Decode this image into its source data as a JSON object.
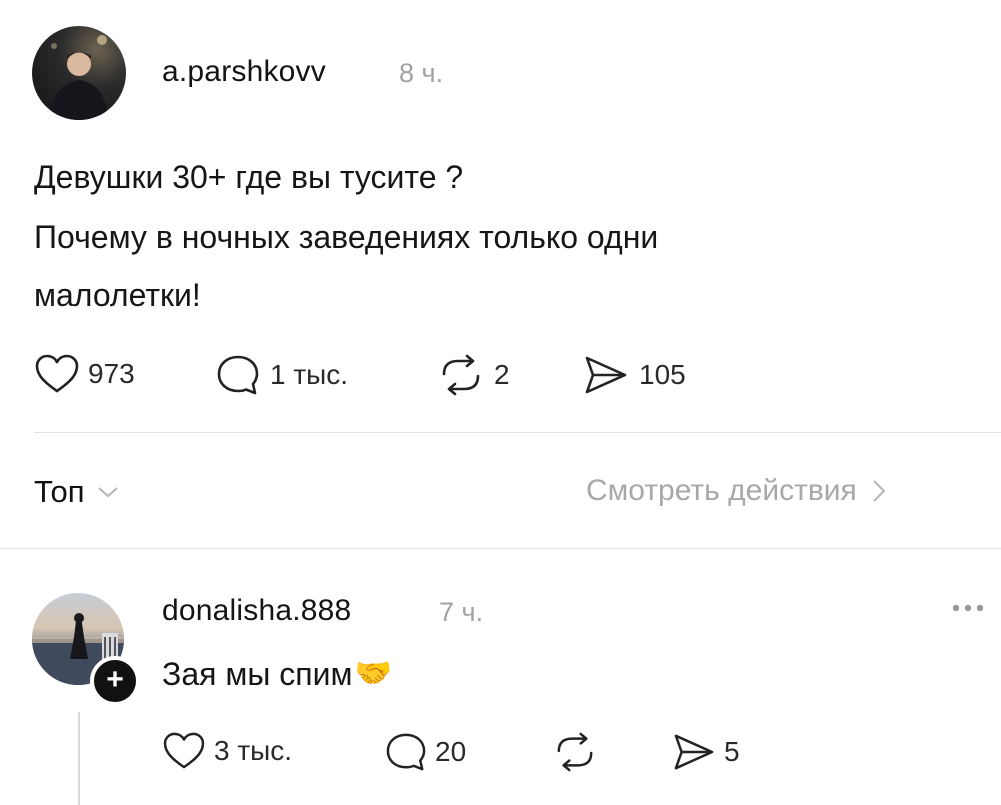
{
  "post": {
    "author": "a.parshkovv",
    "time": "8 ч.",
    "lines": [
      "Девушки 30+ где вы тусите ?",
      "Почему в ночных заведениях только  одни",
      "малолетки!"
    ],
    "stats": {
      "likes": "973",
      "comments": "1 тыс.",
      "reposts": "2",
      "shares": "105"
    }
  },
  "replies_header": {
    "sort_label": "Топ",
    "activity_label": "Смотреть действия"
  },
  "reply": {
    "author": "donalisha.888",
    "time": "7 ч.",
    "text": "Зая мы спим",
    "emoji": "🤝",
    "stats": {
      "likes": "3 тыс.",
      "comments": "20",
      "reposts": "",
      "shares": "5"
    }
  },
  "icons": {
    "like": "heart-outline-icon",
    "comment": "speech-bubble-icon",
    "repost": "repost-arrows-icon",
    "share": "send-paper-plane-icon",
    "more": "more-dots-icon",
    "follow": "plus-icon",
    "sort": "chevron-down-icon",
    "activity": "chevron-right-icon"
  },
  "colors": {
    "text": "#111111",
    "muted": "#a2a2a2",
    "divider": "#e2e2e2"
  }
}
